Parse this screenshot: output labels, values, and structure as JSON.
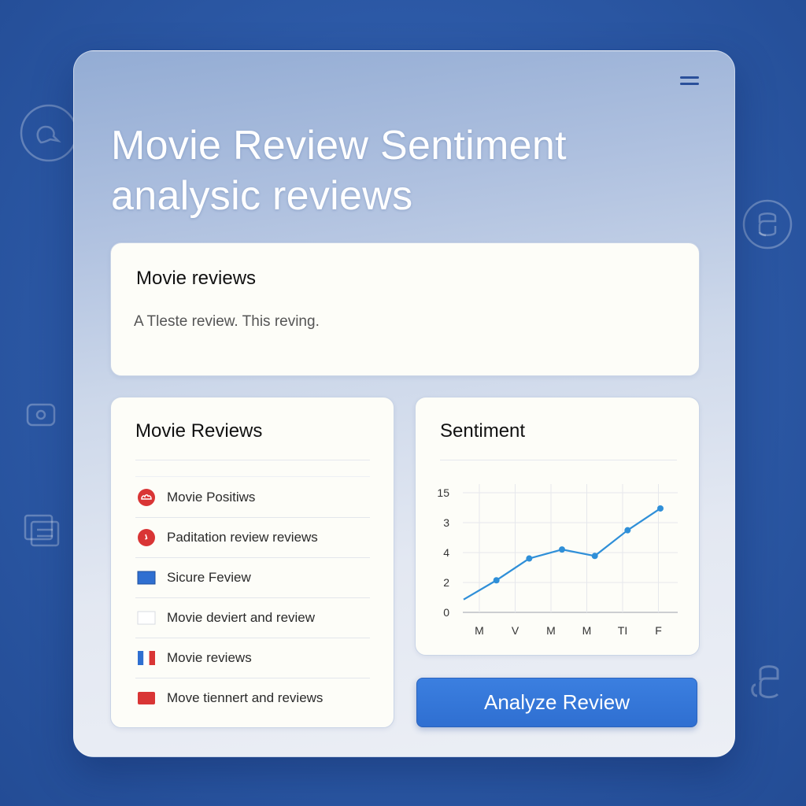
{
  "header": {
    "title_line1": "Movie Review Sentiment",
    "title_line2": "analysic reviews"
  },
  "review_input": {
    "label": "Movie reviews",
    "value": "A Tleste review. This reving."
  },
  "reviews_list": {
    "title": "Movie Reviews",
    "items": [
      {
        "label": "Movie Positiws",
        "icon": "red-round-icon",
        "color": "#d93535"
      },
      {
        "label": "Paditation review reviews",
        "icon": "red-round-icon",
        "color": "#d93535"
      },
      {
        "label": "Sicure Feview",
        "icon": "blue-square-icon",
        "color": "#2f6fd1"
      },
      {
        "label": "Movie deviert and review",
        "icon": "blank-square-icon",
        "color": "#ffffff"
      },
      {
        "label": "Movie reviews",
        "icon": "flag-icon",
        "color": "#2f6fd1"
      },
      {
        "label": "Move tiennert and reviews",
        "icon": "red-square-icon",
        "color": "#d93535"
      }
    ]
  },
  "sentiment": {
    "title": "Sentiment"
  },
  "chart_data": {
    "type": "line",
    "title": "Sentiment",
    "categories": [
      "M",
      "V",
      "M",
      "M",
      "TI",
      "F"
    ],
    "y_ticks": [
      "15",
      "3",
      "4",
      "2",
      "0"
    ],
    "series": [
      {
        "values": [
          1.0,
          2.5,
          4.2,
          4.9,
          4.4,
          6.4,
          8.1
        ]
      }
    ],
    "ylim": [
      0,
      10
    ],
    "grid": true,
    "line_color": "#2f8fd8"
  },
  "actions": {
    "analyze_label": "Analyze Review"
  }
}
